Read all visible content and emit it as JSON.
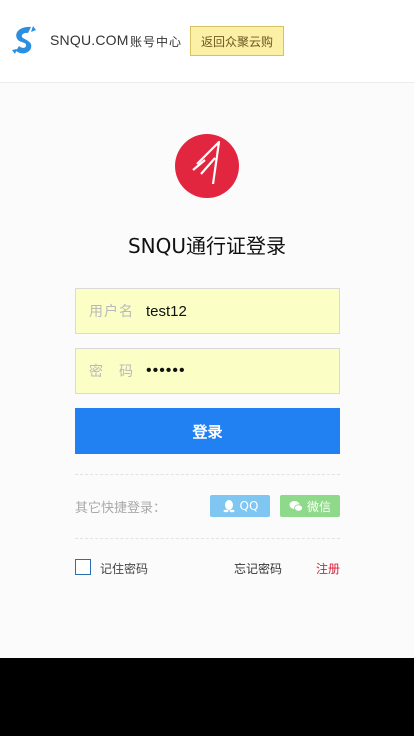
{
  "header": {
    "brand_name": "SNQU.COM",
    "brand_sub": "账号中心",
    "back_button": "返回众聚云购"
  },
  "main": {
    "title": "SNQU通行证登录",
    "username": {
      "label": "用户名",
      "value": "test12"
    },
    "password": {
      "label": "密　码",
      "value": "••••••"
    },
    "login_button": "登录",
    "quick_login_label": "其它快捷登录：",
    "qq_button": "QQ",
    "wechat_button": "微信",
    "remember_label": "记住密码",
    "forgot_link": "忘记密码",
    "register_link": "注册"
  },
  "colors": {
    "login_button": "#2181f3",
    "field_bg": "#fbffc6",
    "back_button_bg": "#fcefa6",
    "logo_red": "#e3263f",
    "register_link": "#d81e3a",
    "qq": "#7fc6f3",
    "wechat": "#8fd98a"
  },
  "icons": {
    "brand_logo": "snqu-s-logo-icon",
    "main_logo": "snqu-red-circle-logo-icon",
    "qq": "qq-penguin-icon",
    "wechat": "wechat-bubbles-icon"
  }
}
